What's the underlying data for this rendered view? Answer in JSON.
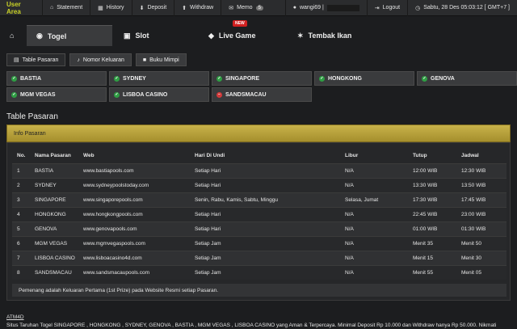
{
  "topbar": {
    "brand": "User Area",
    "items": [
      {
        "icon": "home-icon",
        "label": "Statement"
      },
      {
        "icon": "history-icon",
        "label": "History"
      },
      {
        "icon": "deposit-icon",
        "label": "Deposit"
      },
      {
        "icon": "withdraw-icon",
        "label": "Withdraw"
      },
      {
        "icon": "memo-icon",
        "label": "Memo",
        "badge": "5"
      }
    ],
    "username": "wangi69 |",
    "logout_label": "Logout",
    "datetime": "Sabtu, 28 Des 05:03:12 [ GMT+7 ]"
  },
  "mainnav": {
    "togel": "Togel",
    "slot": "Slot",
    "live_game": "Live Game",
    "new_badge": "NEW",
    "tembak_ikan": "Tembak Ikan"
  },
  "subtabs": [
    "Table Pasaran",
    "Nomor Keluaran",
    "Buku Mimpi"
  ],
  "markets": [
    {
      "name": "BASTIA",
      "status": "open"
    },
    {
      "name": "SYDNEY",
      "status": "open"
    },
    {
      "name": "SINGAPORE",
      "status": "open"
    },
    {
      "name": "HONGKONG",
      "status": "open"
    },
    {
      "name": "GENOVA",
      "status": "open"
    },
    {
      "name": "MGM VEGAS",
      "status": "open"
    },
    {
      "name": "LISBOA CASINO",
      "status": "open"
    },
    {
      "name": "SANDSMACAU",
      "status": "closed"
    }
  ],
  "page_title": "Table Pasaran",
  "info_bar": "Info Pasaran",
  "table": {
    "headers": [
      "No.",
      "Nama Pasaran",
      "Web",
      "Hari Di Undi",
      "Libur",
      "Tutup",
      "Jadwal"
    ],
    "rows": [
      [
        "1",
        "BASTIA",
        "www.bastiapools.com",
        "Setiap Hari",
        "N/A",
        "12:00 WIB",
        "12:30 WIB"
      ],
      [
        "2",
        "SYDNEY",
        "www.sydneypoolstoday.com",
        "Setiap Hari",
        "N/A",
        "13:30 WIB",
        "13:50 WIB"
      ],
      [
        "3",
        "SINGAPORE",
        "www.singaporepools.com",
        "Senin, Rabu, Kamis, Sabtu, Minggu",
        "Selasa, Jumat",
        "17:30 WIB",
        "17:45 WIB"
      ],
      [
        "4",
        "HONGKONG",
        "www.hongkongpools.com",
        "Setiap Hari",
        "N/A",
        "22:45 WIB",
        "23:00 WIB"
      ],
      [
        "5",
        "GENOVA",
        "www.genovapools.com",
        "Setiap Hari",
        "N/A",
        "01:00 WIB",
        "01:30 WIB"
      ],
      [
        "6",
        "MGM VEGAS",
        "www.mgmvegaspools.com",
        "Setiap Jam",
        "N/A",
        "Menit 35",
        "Menit 50"
      ],
      [
        "7",
        "LISBOA CASINO",
        "www.lisboacasino4d.com",
        "Setiap Jam",
        "N/A",
        "Menit 15",
        "Menit 30"
      ],
      [
        "8",
        "SANDSMACAU",
        "www.sandsmacaupools.com",
        "Setiap Jam",
        "N/A",
        "Menit 55",
        "Menit 05"
      ]
    ],
    "note": "Pemenang adalah Keluaran Pertama (1st Prize) pada Website Resmi setiap Pasaran."
  },
  "footer": {
    "title": "ATM4D",
    "description": "Situs Taruhan Togel SINGAPORE , HONGKONG , SYDNEY, GENOVA , BASTIA , MGM VEGAS , LISBOA CASINO yang Aman & Terpercaya. Minimal Deposit Rp 10.000 dan Withdraw hanya Rp 50.000. Nikmati"
  },
  "colors": {
    "brand": "#c9d227",
    "info_bar": "#b9a33c",
    "open": "#2f9e44",
    "closed": "#d23a3a"
  }
}
